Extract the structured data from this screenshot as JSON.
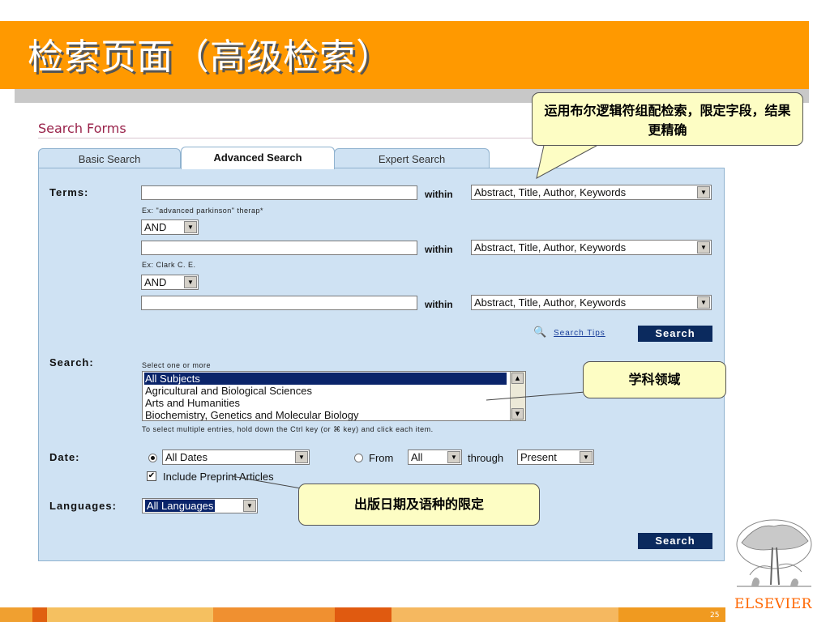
{
  "header": {
    "title": "检索页面（高级检索）"
  },
  "page_number": "25",
  "publisher_logo": {
    "label": "ELSEVIER"
  },
  "callouts": {
    "logic": "运用布尔逻辑符组配检索，限定字段，结果更精确",
    "subject": "学科领域",
    "date_lang": "出版日期及语种的限定"
  },
  "form": {
    "title": "Search Forms",
    "tabs": [
      {
        "label": "Basic Search",
        "active": false
      },
      {
        "label": "Advanced Search",
        "active": true
      },
      {
        "label": "Expert Search",
        "active": false
      }
    ],
    "terms": {
      "label": "Terms:",
      "within_label": "within",
      "rows": [
        {
          "value": "",
          "field": "Abstract, Title, Author, Keywords",
          "example": "Ex: \"advanced parkinson\" therap*"
        },
        {
          "value": "",
          "field": "Abstract, Title, Author, Keywords",
          "example": "Ex: Clark C. E."
        },
        {
          "value": "",
          "field": "Abstract, Title, Author, Keywords"
        }
      ],
      "operators": [
        "AND",
        "AND"
      ]
    },
    "search_tips": "Search Tips",
    "search_button": "Search",
    "subjects": {
      "label": "Search:",
      "hint": "Select one or more",
      "options": [
        "All Subjects",
        "Agricultural and Biological Sciences",
        "Arts and Humanities",
        "Biochemistry, Genetics and Molecular Biology"
      ],
      "selected": "All Subjects",
      "multi_hint": "To select multiple entries, hold down the Ctrl key (or ⌘ key) and click each item."
    },
    "date": {
      "label": "Date:",
      "range_value": "All Dates",
      "from_label": "From",
      "from_value": "All",
      "through_label": "through",
      "through_value": "Present",
      "preprint_label": "Include Preprint Articles",
      "preprint_checked": true
    },
    "languages": {
      "label": "Languages:",
      "value": "All Languages"
    }
  },
  "colors": {
    "title_bar": "#ff9900",
    "panel": "#cfe2f3",
    "button": "#0b2a5e",
    "callout": "#fdfdc4"
  }
}
